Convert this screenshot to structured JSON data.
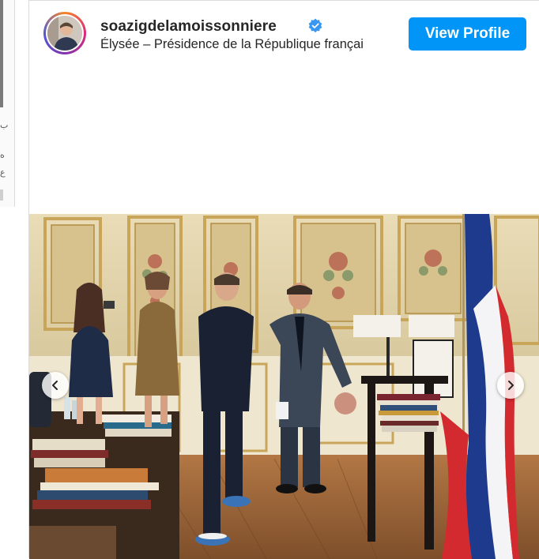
{
  "post": {
    "username": "soazigdelamoissonniere",
    "verified": true,
    "location": "Élysée – Présidence de la République françai",
    "view_profile_label": "View Profile"
  },
  "colors": {
    "button_blue": "#0095f6",
    "verified_blue": "#3897f0",
    "text": "#262626",
    "border": "#dbdbdb"
  },
  "icons": {
    "verified": "verified-badge-icon",
    "prev": "chevron-left-icon",
    "next": "chevron-right-icon"
  }
}
